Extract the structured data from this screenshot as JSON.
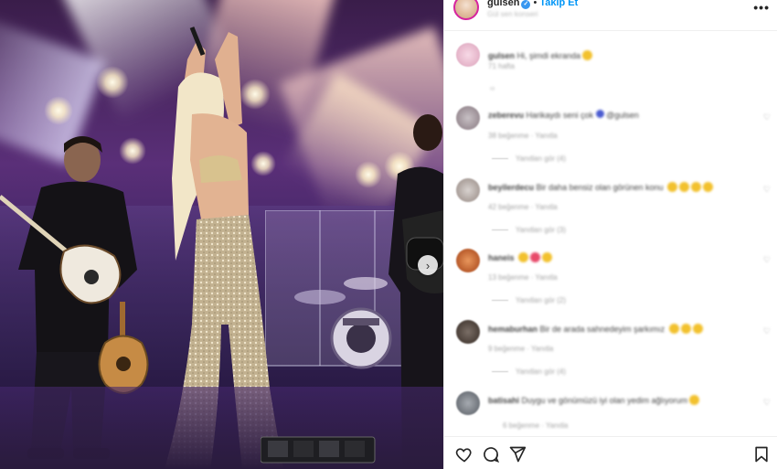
{
  "post": {
    "username": "gulsen",
    "verified": true,
    "separator": "•",
    "follow_label": "Takip Et",
    "subtitle": "Gül sen konseri",
    "more_label": "•••"
  },
  "photo": {
    "next_label": "›"
  },
  "comments": [
    {
      "user": "gulsen",
      "text": "Hi, şimdi ekranda",
      "meta": "71 hafta",
      "reply": ""
    },
    {
      "user": "zeberevu",
      "text": "Harikaydı seni çok",
      "meta": "38 beğenme · Yanıtla",
      "reply": "Yanıtları gör (4)"
    },
    {
      "user": "beyilerdecu",
      "text": "Bir daha bensiz olan görünen konu",
      "meta": "42 beğenme · Yanıtla",
      "reply": "Yanıtları gör (3)"
    },
    {
      "user": "haneis",
      "text": "",
      "meta": "13 beğenme · Yanıtla",
      "reply": "Yanıtları gör (2)"
    },
    {
      "user": "hemaburhan",
      "text": "Bir de arada sahnedeyim şarkımız",
      "meta": "9 beğenme · Yanıtla",
      "reply": "Yanıtları gör (4)"
    },
    {
      "user": "batisahi",
      "text": "Duygu ve gönümüzü iyi olan yedim ağlıyorum",
      "meta": "6 beğenme · Yanıtla",
      "reply": ""
    }
  ],
  "colors": {
    "follow": "#0095f6",
    "verified": "#3897f0",
    "muted": "#8e8e8e"
  },
  "icons": [
    "heart-icon",
    "comment-icon",
    "share-icon",
    "bookmark-icon",
    "more-icon",
    "chevron-right-icon"
  ]
}
